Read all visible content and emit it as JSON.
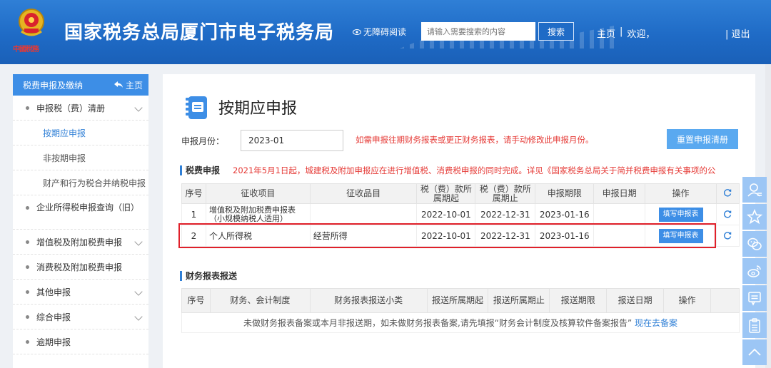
{
  "header": {
    "site_title": "国家税务总局厦门市电子税务局",
    "emblem_text": "中國稅務",
    "accessibility": "无障碍阅读",
    "search_placeholder": "请输入需要搜索的内容",
    "search_button": "搜索",
    "home": "主页",
    "separator": "|",
    "welcome": "欢迎，",
    "logout": "| 退出"
  },
  "sidebar": {
    "header_label": "税费申报及缴纳",
    "home_label": "主页",
    "items": [
      {
        "label": "申报税（费）清册",
        "type": "group"
      },
      {
        "label": "按期应申报",
        "type": "sub",
        "active": true
      },
      {
        "label": "非按期申报",
        "type": "sub"
      },
      {
        "label": "财产和行为税合并纳税申报",
        "type": "sub"
      },
      {
        "label": "企业所得税申报查询（旧）",
        "type": "group"
      },
      {
        "label": "增值税及附加税费申报",
        "type": "group"
      },
      {
        "label": "消费税及附加税费申报",
        "type": "group"
      },
      {
        "label": "其他申报",
        "type": "group"
      },
      {
        "label": "综合申报",
        "type": "group"
      },
      {
        "label": "逾期申报",
        "type": "group"
      }
    ]
  },
  "main": {
    "title": "按期应申报",
    "month_label": "申报月份：",
    "month_value": "2023-01",
    "month_tip": "如需申报往期财务报表或更正财务报表，请手动修改此申报月份。",
    "reset_button": "重置申报清册",
    "tax_section": {
      "title": "税费申报",
      "notice": "2021年5月1日起，城建税及附加申报应在进行增值税、消费税申报的同时完成。详见《国家税务总局关于简并税费申报有关事项的公",
      "columns": [
        "序号",
        "征收项目",
        "征收品目",
        "税（费）款所属期起",
        "税（费）款所属期止",
        "申报期限",
        "申报日期",
        "操作"
      ],
      "rows": [
        {
          "no": "1",
          "item": "增值税及附加税费申报表（小规模纳税人适用）",
          "category": "",
          "start": "2022-10-01",
          "end": "2022-12-31",
          "deadline": "2023-01-16",
          "date": "",
          "action": "填写申报表"
        },
        {
          "no": "2",
          "item": "个人所得税",
          "category": "经营所得",
          "start": "2022-10-01",
          "end": "2022-12-31",
          "deadline": "2023-01-16",
          "date": "",
          "action": "填写申报表"
        }
      ]
    },
    "finance_section": {
      "title": "财务报表报送",
      "columns": [
        "序号",
        "财务、会计制度",
        "财务报表报送小类",
        "报送所属期起",
        "报送所属期止",
        "报送期限",
        "报送日期",
        "操作"
      ],
      "empty_text": "未做财务报表备案或本月非报送期，如未做财务报表备案,请先填报“财务会计制度及核算软件备案报告”",
      "empty_link": "现在去备案"
    }
  },
  "floatbar": [
    "user-icon",
    "star-icon",
    "wechat-icon",
    "weibo-icon",
    "message-icon",
    "clipboard-icon",
    "back-to-top-icon"
  ],
  "colors": {
    "header_blue": "#1f6bc6",
    "accent_blue": "#3d8ee6",
    "alert_red": "#e53935",
    "highlight_red": "#e0202a"
  }
}
